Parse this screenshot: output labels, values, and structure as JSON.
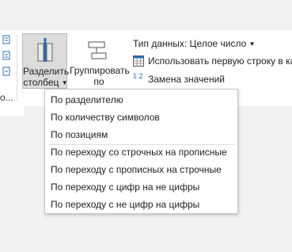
{
  "ribbon": {
    "left_truncated_label": "о...",
    "split_column": {
      "label_line1": "Разделить",
      "label_line2": "столбец",
      "has_dropdown": true
    },
    "group_by": {
      "label_line1": "Группировать",
      "label_line2": "по"
    },
    "data_type": {
      "label": "Тип данных: Целое число",
      "has_dropdown": true
    },
    "use_first_row": {
      "label": "Использовать первую строку в кач"
    },
    "replace_values": {
      "label": "Замена значений",
      "icon_digits": "1 2"
    }
  },
  "split_menu": {
    "items": [
      {
        "label": "По разделителю"
      },
      {
        "label": "По количеству символов"
      },
      {
        "label": "По позициям"
      },
      {
        "label": "По переходу со строчных на прописные"
      },
      {
        "label": "По переходу с прописных на строчные"
      },
      {
        "label": "По переходу с цифр на не цифры"
      },
      {
        "label": "По переходу с не цифр на цифры"
      }
    ]
  },
  "colors": {
    "accent_blue": "#2b6cb3",
    "selected_button_bg": "#dcdcdc",
    "ribbon_bg": "#ffffff",
    "app_bg": "#f3f2f1"
  }
}
